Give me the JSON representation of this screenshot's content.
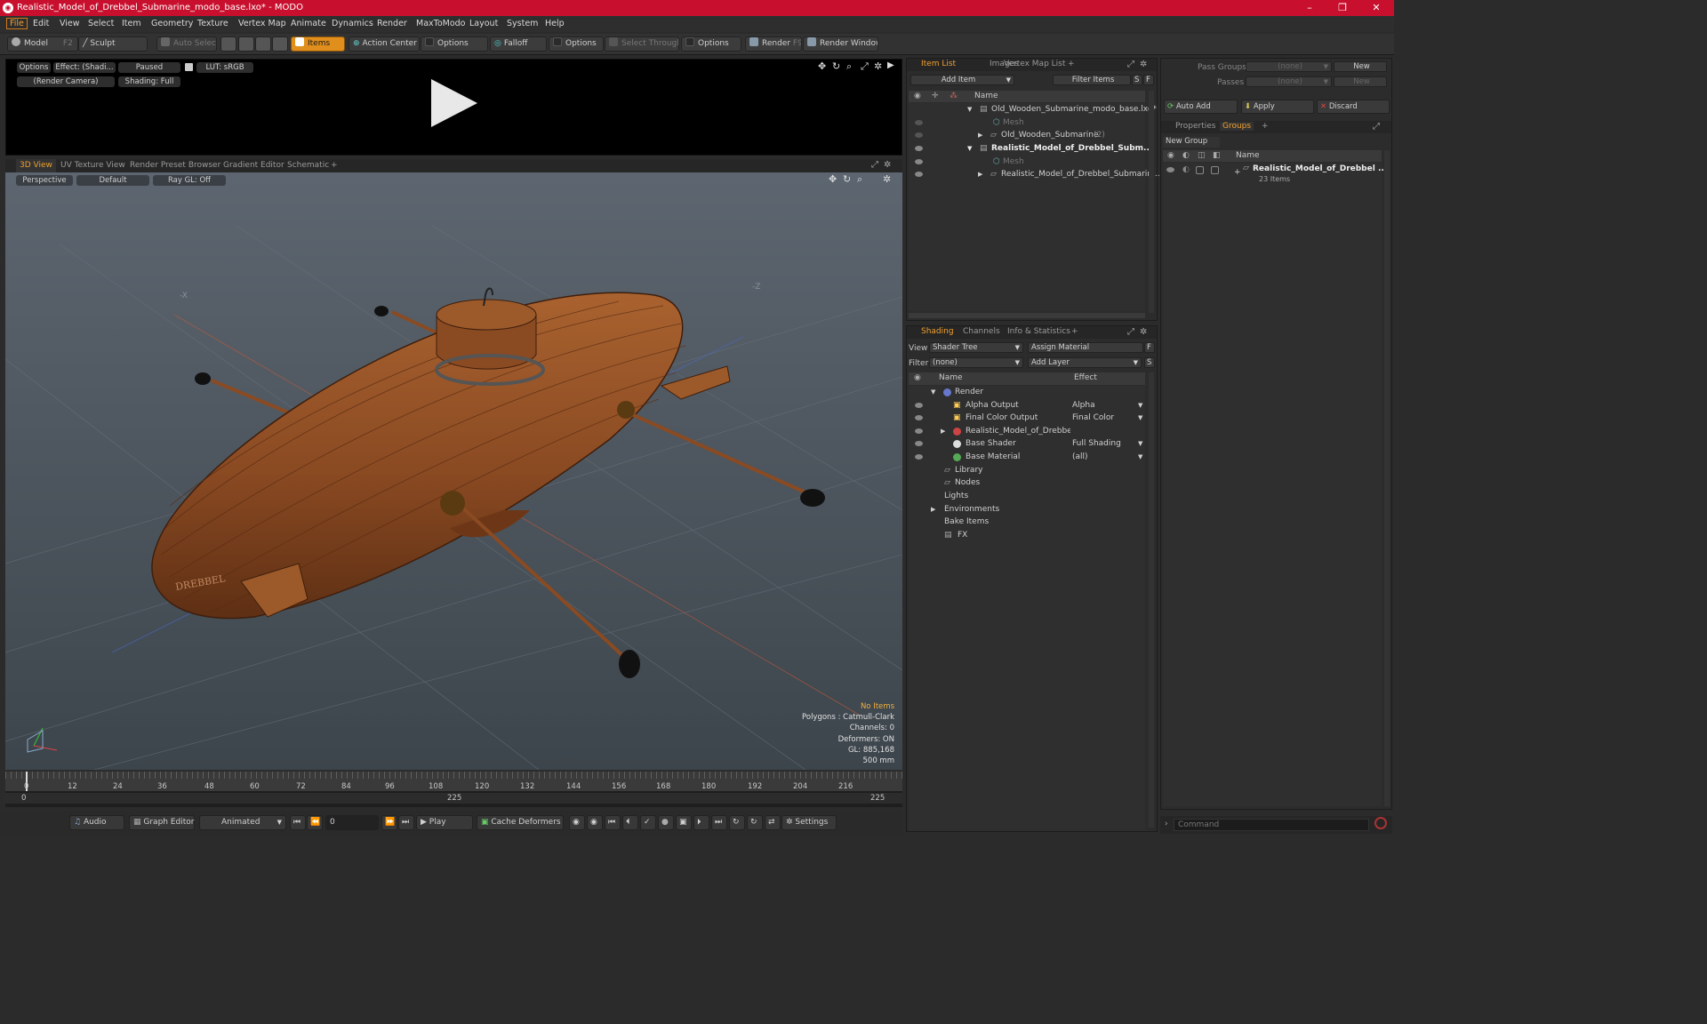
{
  "window": {
    "title": "Realistic_Model_of_Drebbel_Submarine_modo_base.lxo* - MODO",
    "controls": [
      "–",
      "❐",
      "✕"
    ]
  },
  "menu": [
    "File",
    "Edit",
    "View",
    "Select",
    "Item",
    "Geometry",
    "Texture",
    "Vertex Map",
    "Animate",
    "Dynamics",
    "Render",
    "MaxToModo",
    "Layout",
    "System",
    "Help"
  ],
  "toolbar": {
    "model": "Model",
    "model_key": "F2",
    "sculpt": "Sculpt",
    "auto_select": "Auto Select",
    "items": "Items",
    "action_center": "Action Center",
    "options": "Options",
    "falloff": "Falloff",
    "select_through": "Select Through",
    "render": "Render",
    "render_key": "F9",
    "render_window": "Render Window"
  },
  "preview": {
    "options": "Options",
    "effect": "Effect: (Shadi...",
    "paused": "Paused",
    "lut": "LUT: sRGB",
    "camera": "(Render Camera)",
    "shading": "Shading: Full"
  },
  "view_tabs": [
    "3D View",
    "UV Texture View",
    "Render Preset Browser",
    "Gradient Editor",
    "Schematic",
    "+"
  ],
  "viewport": {
    "perspective": "Perspective",
    "default": "Default",
    "raygl": "Ray GL: Off",
    "axis_x": "-X",
    "axis_z": "-Z",
    "stern_text": "DREBBEL"
  },
  "stats": {
    "items": "No Items",
    "polygons": "Polygons : Catmull-Clark",
    "channels": "Channels: 0",
    "deformers": "Deformers: ON",
    "gl": "GL: 885,168",
    "size": "500 mm"
  },
  "timeline": {
    "ticks": [
      "0",
      "12",
      "24",
      "36",
      "48",
      "60",
      "72",
      "84",
      "96",
      "108",
      "120",
      "132",
      "144",
      "156",
      "168",
      "180",
      "192",
      "204",
      "216"
    ],
    "start": "0",
    "mid": "225",
    "end": "225"
  },
  "bottom": {
    "audio": "Audio",
    "graph_editor": "Graph Editor",
    "animated": "Animated",
    "frame": "0",
    "play": "Play",
    "cache": "Cache Deformers",
    "settings": "Settings"
  },
  "item_list": {
    "tabs": [
      "Item List",
      "Images",
      "Vertex Map List",
      "+"
    ],
    "add_item": "Add Item",
    "filter": "Filter Items",
    "s": "S",
    "f": "F",
    "col_name": "Name",
    "rows": [
      {
        "label": "Old_Wooden_Submarine_modo_base.lxo*",
        "bold": false
      },
      {
        "label": "Mesh",
        "dim": true
      },
      {
        "label": "Old_Wooden_Submarine",
        "suffix": "(2)"
      },
      {
        "label": "Realistic_Model_of_Drebbel_Subm...",
        "bold": true
      },
      {
        "label": "Mesh",
        "dim": true
      },
      {
        "label": "Realistic_Model_of_Drebbel_Submarin ..."
      }
    ]
  },
  "shading": {
    "tabs": [
      "Shading",
      "Channels",
      "Info & Statistics",
      "+"
    ],
    "view_label": "View",
    "view_value": "Shader Tree",
    "assign": "Assign Material",
    "filter_label": "Filter",
    "filter_value": "(none)",
    "add_layer": "Add Layer",
    "col_name": "Name",
    "col_effect": "Effect",
    "rows": [
      {
        "label": "Render",
        "effect": ""
      },
      {
        "label": "Alpha Output",
        "effect": "Alpha"
      },
      {
        "label": "Final Color Output",
        "effect": "Final Color"
      },
      {
        "label": "Realistic_Model_of_Drebbe...",
        "effect": ""
      },
      {
        "label": "Base Shader",
        "effect": "Full Shading"
      },
      {
        "label": "Base Material",
        "effect": "(all)"
      },
      {
        "label": "Library",
        "effect": ""
      },
      {
        "label": "Nodes",
        "effect": ""
      },
      {
        "label": "Lights",
        "effect": ""
      },
      {
        "label": "Environments",
        "effect": ""
      },
      {
        "label": "Bake Items",
        "effect": ""
      },
      {
        "label": "FX",
        "effect": ""
      }
    ]
  },
  "right": {
    "pass_groups": "Pass Groups",
    "passes": "Passes",
    "none": "(none)",
    "new": "New",
    "auto_add": "Auto Add",
    "apply": "Apply",
    "discard": "Discard",
    "tabs": [
      "Properties",
      "Groups",
      "+"
    ],
    "new_group": "New Group",
    "col_name": "Name",
    "group_name": "Realistic_Model_of_Drebbel ...",
    "group_count": "23 Items"
  },
  "command": {
    "placeholder": "Command"
  }
}
